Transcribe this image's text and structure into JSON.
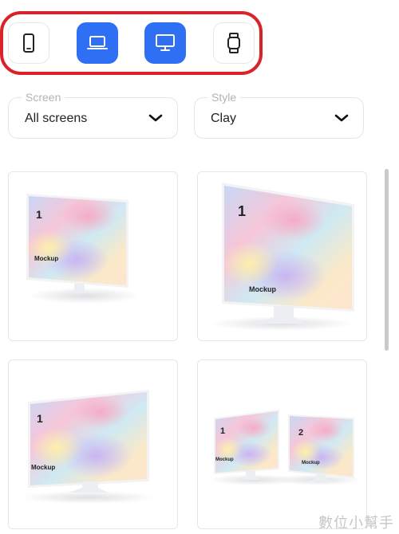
{
  "device_toolbar": {
    "buttons": [
      {
        "name": "phone",
        "icon": "phone-icon",
        "active": false
      },
      {
        "name": "laptop",
        "icon": "laptop-icon",
        "active": true
      },
      {
        "name": "desktop",
        "icon": "desktop-monitor-icon",
        "active": true
      },
      {
        "name": "watch",
        "icon": "smartwatch-icon",
        "active": false
      }
    ],
    "active_color": "#2f6ff3",
    "highlight_color": "#d9222a"
  },
  "filters": {
    "screen": {
      "label": "Screen",
      "value": "All screens"
    },
    "style": {
      "label": "Style",
      "value": "Clay"
    }
  },
  "mockups": [
    {
      "numbers": [
        "1"
      ],
      "caption": "Mockup"
    },
    {
      "numbers": [
        "1"
      ],
      "caption": "Mockup"
    },
    {
      "numbers": [
        "1"
      ],
      "caption": "Mockup"
    },
    {
      "numbers": [
        "1",
        "2"
      ],
      "captions": [
        "Mockup",
        "Mockup"
      ]
    }
  ],
  "watermark": "數位小幫手"
}
